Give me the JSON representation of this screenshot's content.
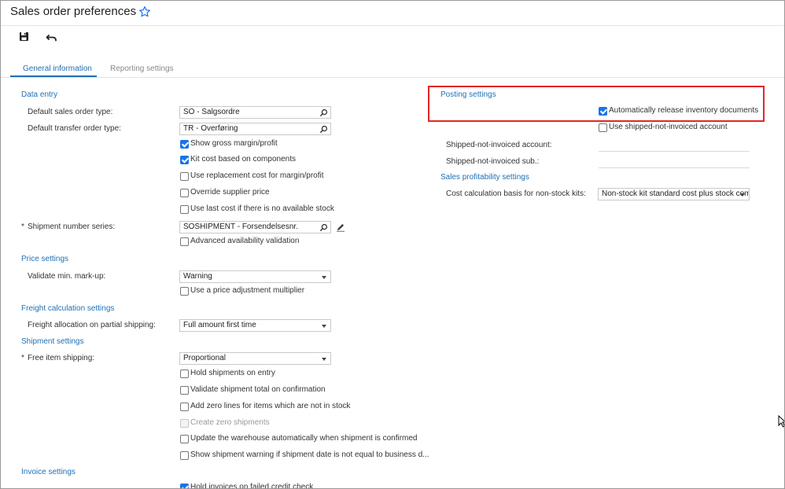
{
  "header": {
    "title": "Sales order preferences",
    "favorite_icon": "star-outline-icon"
  },
  "toolbar": {
    "save_icon": "save-icon",
    "undo_icon": "undo-icon"
  },
  "tabs": [
    {
      "label": "General information",
      "active": true
    },
    {
      "label": "Reporting settings",
      "active": false
    }
  ],
  "left": {
    "data_entry": {
      "title": "Data entry",
      "default_so_type_label": "Default sales order type:",
      "default_so_type_value": "SO - Salgsordre",
      "default_to_type_label": "Default transfer order type:",
      "default_to_type_value": "TR - Overføring",
      "checkboxes": [
        {
          "label": "Show gross margin/profit",
          "checked": true
        },
        {
          "label": "Kit cost based on components",
          "checked": true
        },
        {
          "label": "Use replacement cost for margin/profit",
          "checked": false
        },
        {
          "label": "Override supplier price",
          "checked": false
        },
        {
          "label": "Use last cost if there is no available stock",
          "checked": false
        }
      ],
      "shipment_series_label": "Shipment number series:",
      "shipment_series_value": "SOSHIPMENT - Forsendelsesnr.",
      "advanced_availability": {
        "label": "Advanced availability validation",
        "checked": false
      }
    },
    "price_settings": {
      "title": "Price settings",
      "validate_label": "Validate min. mark-up:",
      "validate_value": "Warning",
      "price_adjust": {
        "label": "Use a price adjustment multiplier",
        "checked": false
      }
    },
    "freight": {
      "title": "Freight calculation settings",
      "allocation_label": "Freight allocation on partial shipping:",
      "allocation_value": "Full amount first time"
    },
    "shipment": {
      "title": "Shipment settings",
      "free_item_label": "Free item shipping:",
      "free_item_value": "Proportional",
      "checkboxes": [
        {
          "label": "Hold shipments on entry",
          "checked": false,
          "disabled": false
        },
        {
          "label": "Validate shipment total on confirmation",
          "checked": false,
          "disabled": false
        },
        {
          "label": "Add zero lines for items which are not in stock",
          "checked": false,
          "disabled": false
        },
        {
          "label": "Create zero shipments",
          "checked": false,
          "disabled": true
        },
        {
          "label": "Update the warehouse automatically when shipment is confirmed",
          "checked": false,
          "disabled": false
        },
        {
          "label": "Show shipment warning if shipment date is not equal to business d...",
          "checked": false,
          "disabled": false
        }
      ]
    },
    "invoice": {
      "title": "Invoice settings",
      "hold_invoices": {
        "label": "Hold invoices on failed credit check",
        "checked": true
      }
    }
  },
  "right": {
    "posting": {
      "title": "Posting settings",
      "auto_release": {
        "label": "Automatically release inventory documents",
        "checked": true
      },
      "use_shipped": {
        "label": "Use shipped-not-invoiced account",
        "checked": false
      },
      "shipped_account_label": "Shipped-not-invoiced account:",
      "shipped_sub_label": "Shipped-not-invoiced sub.:"
    },
    "profitability": {
      "title": "Sales profitability settings",
      "cost_basis_label": "Cost calculation basis for non-stock kits:",
      "cost_basis_value": "Non-stock kit standard cost plus stock com"
    }
  },
  "colors": {
    "accent": "#1f6fb5",
    "highlight": "#e32626",
    "checkbox": "#1a73e8"
  }
}
